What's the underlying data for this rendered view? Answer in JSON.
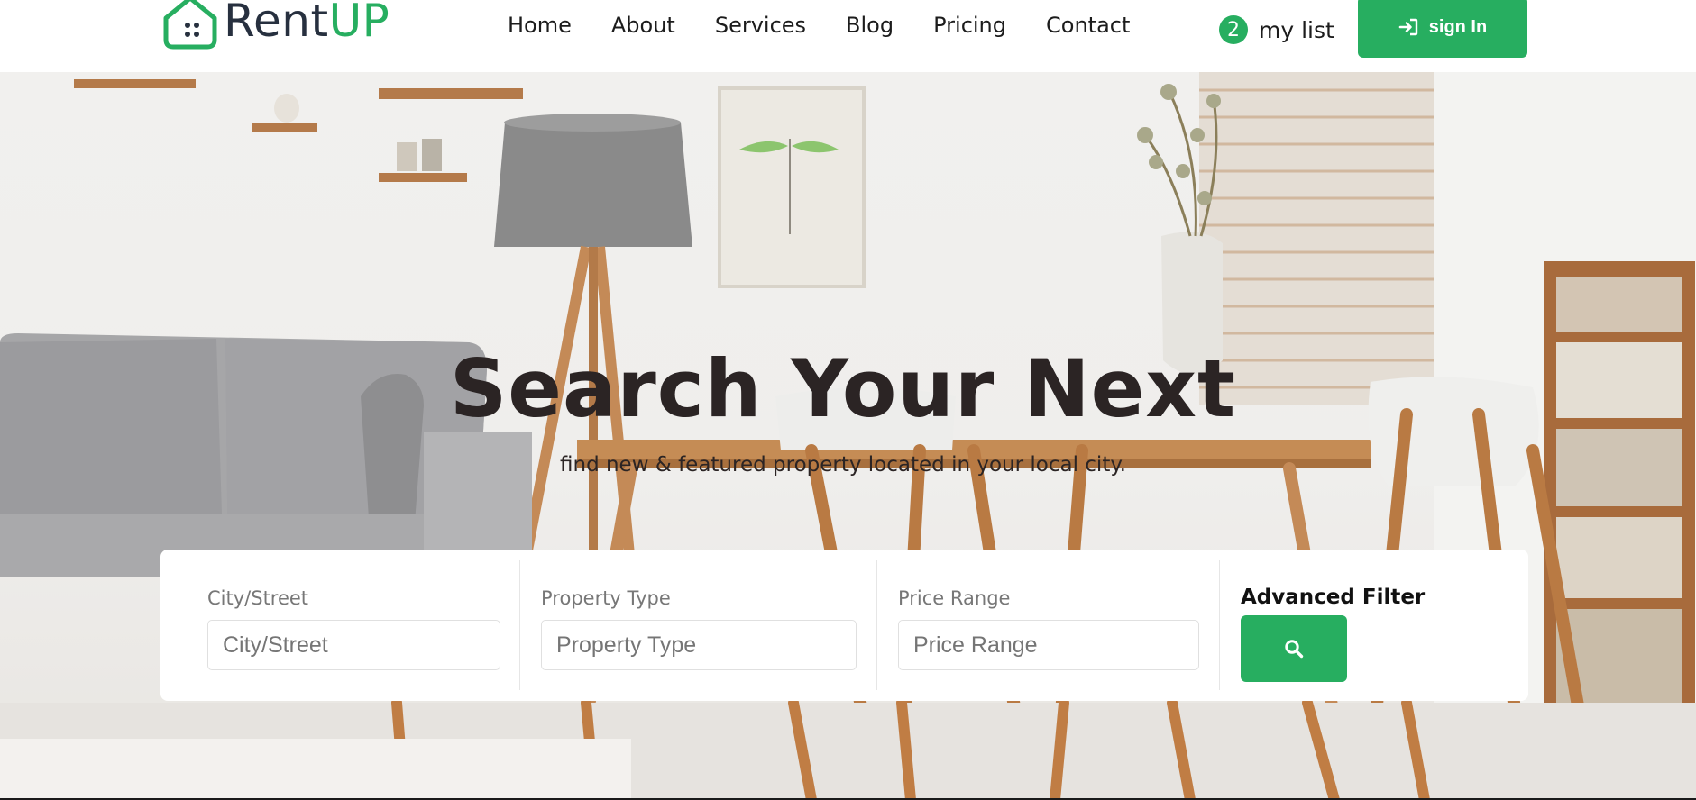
{
  "brand": {
    "name_part1": "Rent",
    "name_part2": "UP"
  },
  "nav": {
    "items": [
      {
        "label": "Home"
      },
      {
        "label": "About"
      },
      {
        "label": "Services"
      },
      {
        "label": "Blog"
      },
      {
        "label": "Pricing"
      },
      {
        "label": "Contact"
      }
    ]
  },
  "mylist": {
    "count": "2",
    "label": "my list"
  },
  "signin": {
    "label": "sign In",
    "icon": "sign-in-icon"
  },
  "hero": {
    "title": "Search Your Next",
    "subtitle": "find new & featured property located in your local city."
  },
  "search": {
    "city": {
      "label": "City/Street",
      "placeholder": "City/Street"
    },
    "property_type": {
      "label": "Property Type",
      "placeholder": "Property Type"
    },
    "price_range": {
      "label": "Price Range",
      "placeholder": "Price Range"
    },
    "advanced_filter_label": "Advanced Filter",
    "button_icon": "search-icon"
  },
  "colors": {
    "accent": "#27ae60",
    "text_dark": "#2b2424",
    "navy": "#27303f"
  }
}
